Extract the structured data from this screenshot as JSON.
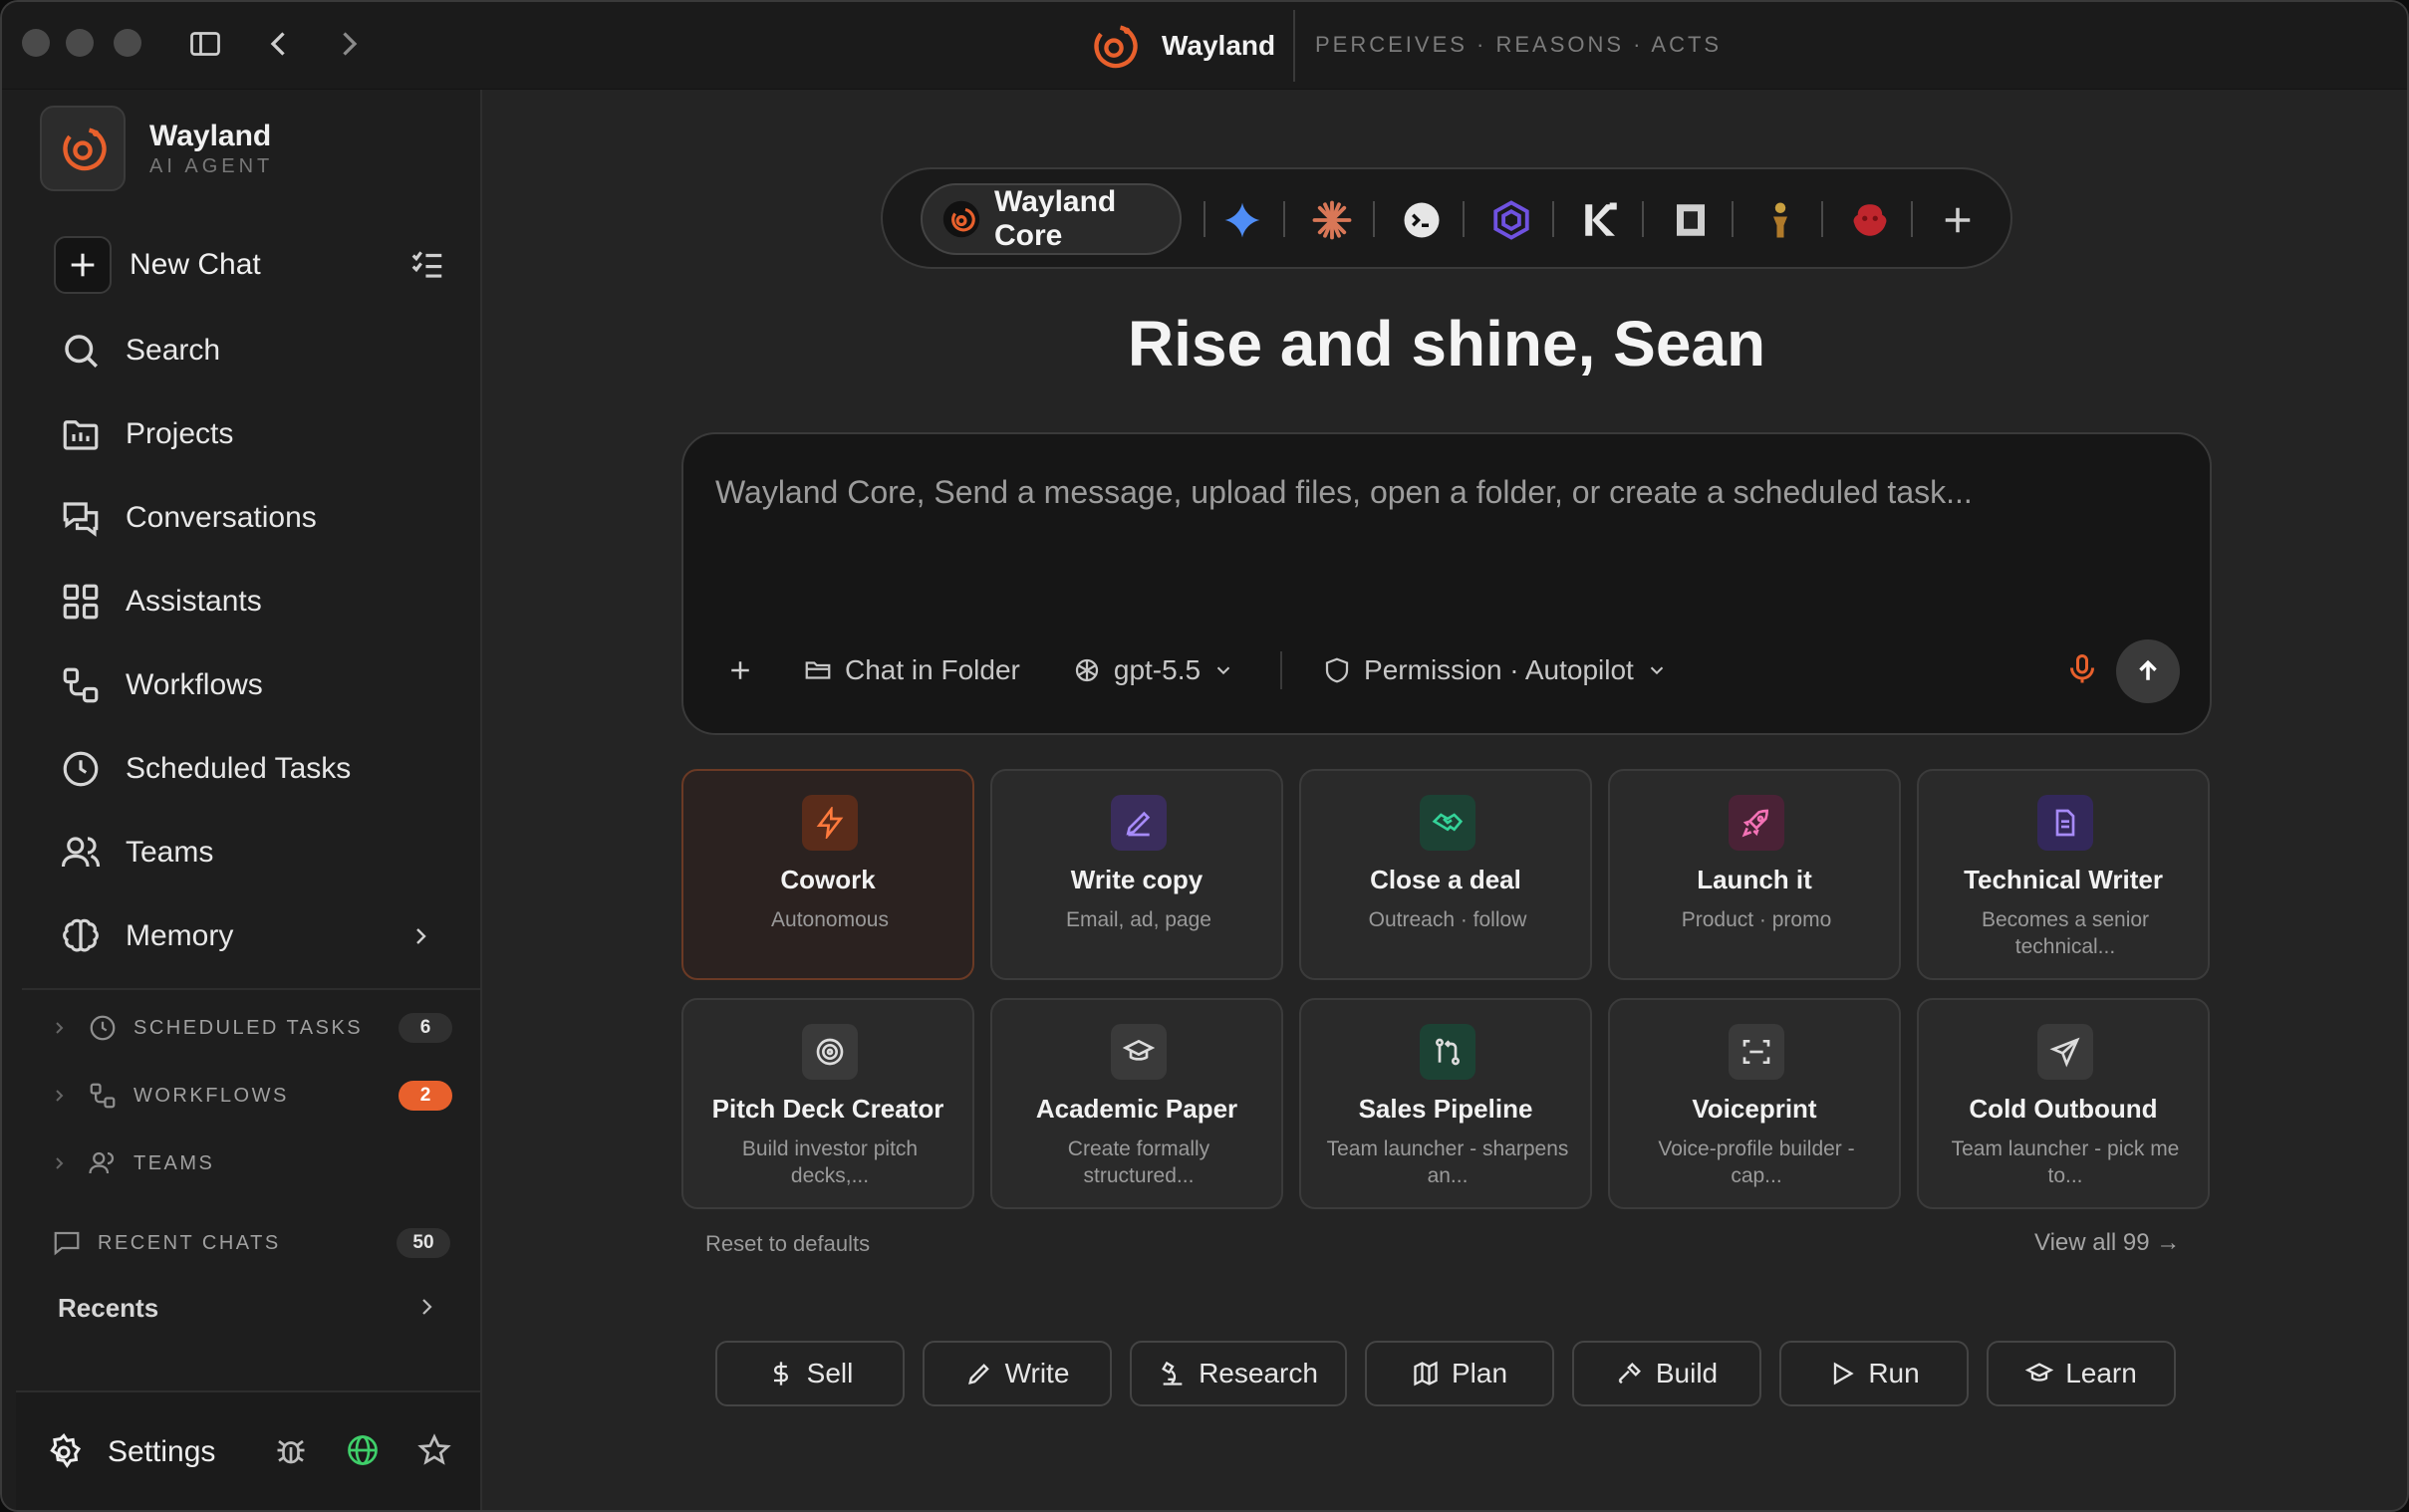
{
  "window": {
    "brand_name": "Wayland",
    "tagline": "PERCEIVES · REASONS · ACTS"
  },
  "sidebar": {
    "app_name": "Wayland",
    "app_subtitle": "AI AGENT",
    "new_chat_label": "New Chat",
    "nav": [
      {
        "label": "Search",
        "icon": "search-icon"
      },
      {
        "label": "Projects",
        "icon": "projects-folder-icon"
      },
      {
        "label": "Conversations",
        "icon": "conversations-icon"
      },
      {
        "label": "Assistants",
        "icon": "assistants-grid-icon"
      },
      {
        "label": "Workflows",
        "icon": "workflows-icon"
      },
      {
        "label": "Scheduled Tasks",
        "icon": "clock-icon"
      },
      {
        "label": "Teams",
        "icon": "teams-icon"
      },
      {
        "label": "Memory",
        "icon": "brain-icon"
      }
    ],
    "sections": [
      {
        "label": "SCHEDULED TASKS",
        "count": "6"
      },
      {
        "label": "WORKFLOWS",
        "count": "2"
      },
      {
        "label": "TEAMS",
        "count": ""
      }
    ],
    "recent_chats_label": "RECENT CHATS",
    "recent_chats_count": "50",
    "recents_label": "Recents",
    "settings_label": "Settings"
  },
  "main": {
    "active_model": "Wayland Core",
    "model_icons": [
      "gemini-sparkle-icon",
      "claude-asterisk-icon",
      "terminal-model-icon",
      "hexagon-model-icon",
      "kimi-k-icon",
      "square-model-icon",
      "figure-model-icon",
      "red-blob-model-icon",
      "add-model-icon"
    ],
    "greeting": "Rise and shine, Sean",
    "composer": {
      "placeholder": "Wayland Core, Send a message, upload files, open a folder, or create a scheduled task...",
      "folder_label": "Chat in Folder",
      "model_label": "gpt-5.5",
      "permission_label": "Permission · Autopilot"
    },
    "cards": [
      {
        "title": "Cowork",
        "subtitle": "Autonomous",
        "icon": "lightning-icon"
      },
      {
        "title": "Write copy",
        "subtitle": "Email, ad, page",
        "icon": "pen-icon"
      },
      {
        "title": "Close a deal",
        "subtitle": "Outreach · follow",
        "icon": "handshake-icon"
      },
      {
        "title": "Launch it",
        "subtitle": "Product · promo",
        "icon": "rocket-icon"
      },
      {
        "title": "Technical Writer",
        "subtitle": "Becomes a senior technical...",
        "icon": "document-icon"
      },
      {
        "title": "Pitch Deck Creator",
        "subtitle": "Build investor pitch decks,...",
        "icon": "target-icon"
      },
      {
        "title": "Academic Paper",
        "subtitle": "Create formally structured...",
        "icon": "graduation-cap-icon"
      },
      {
        "title": "Sales Pipeline",
        "subtitle": "Team launcher - sharpens an...",
        "icon": "pipeline-icon"
      },
      {
        "title": "Voiceprint",
        "subtitle": "Voice-profile builder - cap...",
        "icon": "scan-icon"
      },
      {
        "title": "Cold Outbound",
        "subtitle": "Team launcher - pick me to...",
        "icon": "send-icon"
      }
    ],
    "reset_label": "Reset to defaults",
    "view_all_label": "View all 99 →",
    "chips": [
      {
        "label": "Sell",
        "icon": "dollar-icon"
      },
      {
        "label": "Write",
        "icon": "pen-icon"
      },
      {
        "label": "Research",
        "icon": "microscope-icon"
      },
      {
        "label": "Plan",
        "icon": "map-icon"
      },
      {
        "label": "Build",
        "icon": "hammer-icon"
      },
      {
        "label": "Run",
        "icon": "play-icon"
      },
      {
        "label": "Learn",
        "icon": "graduation-cap-icon"
      }
    ]
  },
  "colors": {
    "accent": "#e8602c",
    "background": "#242424",
    "sidebar": "#1e1e1e"
  }
}
